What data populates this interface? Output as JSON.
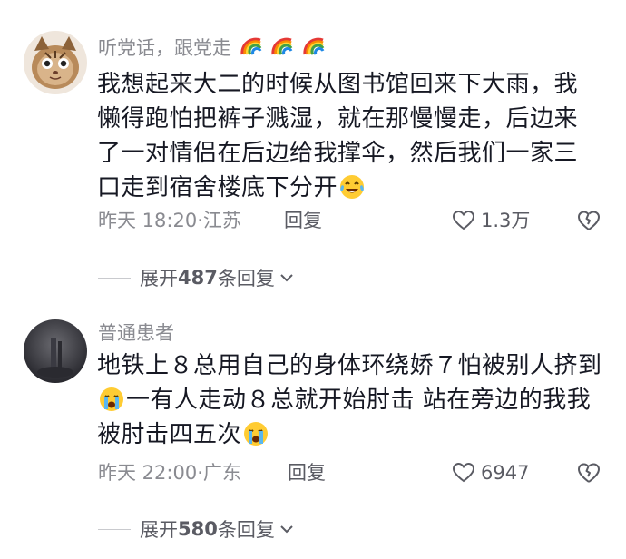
{
  "comments": [
    {
      "username": "听党话，跟党走",
      "username_emojis": [
        "rainbow",
        "rainbow",
        "rainbow"
      ],
      "lines": [
        "我想起来大二的时候从图书馆回来下大雨，我",
        "懒得跑怕把裤子溅湿，就在那慢慢走，后边来",
        "了一对情侣在后边给我撑伞，然后我们一家三",
        "口走到宿舍楼底下分开"
      ],
      "trailing_emoji": "laughing-crying-face",
      "time": "昨天 18:20",
      "location": "江苏",
      "reply_label": "回复",
      "likes": "1.3万",
      "expand_prefix": "展开",
      "expand_count": "487",
      "expand_suffix": "条回复"
    },
    {
      "username": "普通患者",
      "lines": [
        "地铁上８总用自己的身体环绕娇７怕被别人挤到",
        "一有人走动８总就开始肘击 站在旁边的我我",
        "被肘击四五次"
      ],
      "line2_leading_emoji": "loudly-crying-face",
      "trailing_emoji": "loudly-crying-face",
      "time": "昨天 22:00",
      "location": "广东",
      "reply_label": "回复",
      "likes": "6947",
      "expand_prefix": "展开",
      "expand_count": "580",
      "expand_suffix": "条回复"
    }
  ],
  "colors": {
    "text_primary": "#161823",
    "text_secondary": "#8a8b91",
    "divider": "#c9cace"
  }
}
